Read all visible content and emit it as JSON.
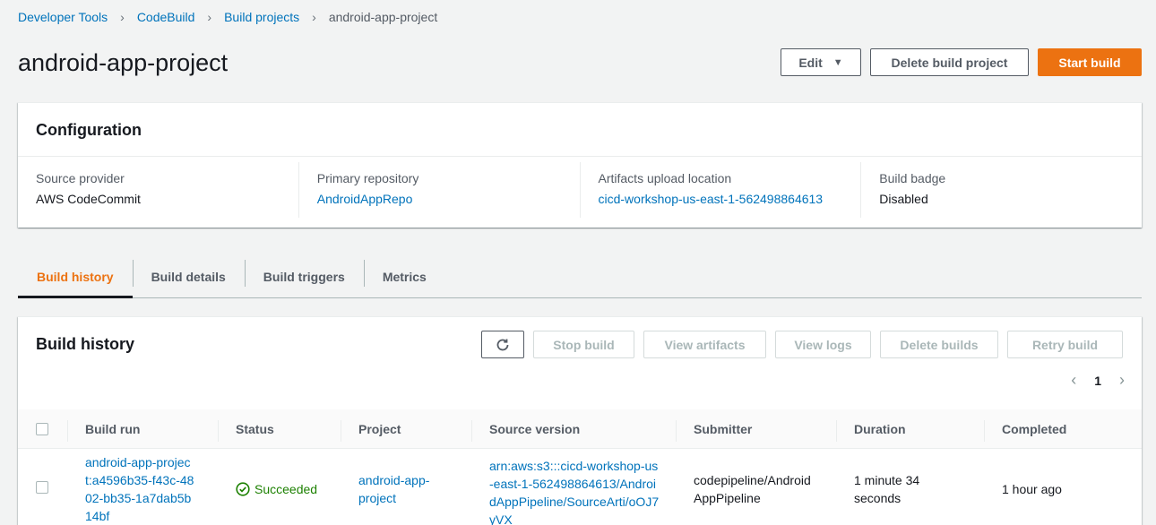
{
  "breadcrumb": {
    "items": [
      "Developer Tools",
      "CodeBuild",
      "Build projects"
    ],
    "current": "android-app-project"
  },
  "header": {
    "title": "android-app-project",
    "edit_label": "Edit",
    "delete_label": "Delete build project",
    "start_label": "Start build"
  },
  "configuration": {
    "title": "Configuration",
    "fields": [
      {
        "label": "Source provider",
        "value": "AWS CodeCommit"
      },
      {
        "label": "Primary repository",
        "value": "AndroidAppRepo"
      },
      {
        "label": "Artifacts upload location",
        "value": "cicd-workshop-us-east-1-562498864613"
      },
      {
        "label": "Build badge",
        "value": "Disabled"
      }
    ]
  },
  "tabs": [
    "Build history",
    "Build details",
    "Build triggers",
    "Metrics"
  ],
  "active_tab": "Build history",
  "history": {
    "title": "Build history",
    "actions": [
      "Stop build",
      "View artifacts",
      "View logs",
      "Delete builds",
      "Retry build"
    ],
    "page": "1",
    "columns": [
      "Build run",
      "Status",
      "Project",
      "Source version",
      "Submitter",
      "Duration",
      "Completed"
    ],
    "rows": [
      {
        "build_run": "android-app-project:a4596b35-f43c-4802-bb35-1a7dab5b14bf",
        "status": "Succeeded",
        "project": "android-app-project",
        "source_version": "arn:aws:s3:::cicd-workshop-us-east-1-562498864613/AndroidAppPipeline/SourceArti/oOJ7yVX",
        "submitter": "codepipeline/AndroidAppPipeline",
        "duration": "1 minute 34 seconds",
        "completed": "1 hour ago"
      }
    ]
  },
  "colors": {
    "accent": "#ec7211",
    "link": "#0073bb",
    "success": "#1d8102"
  }
}
